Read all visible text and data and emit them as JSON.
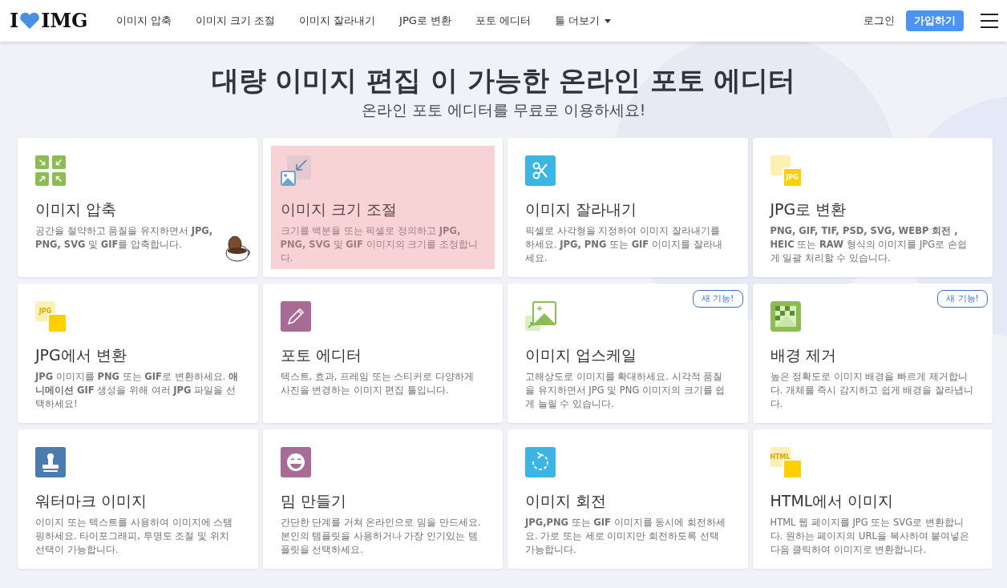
{
  "logo": {
    "left": "I",
    "right": "IMG"
  },
  "nav": {
    "items": [
      {
        "label": "이미지 압축"
      },
      {
        "label": "이미지 크기 조절"
      },
      {
        "label": "이미지 잘라내기"
      },
      {
        "label": "JPG로 변환"
      },
      {
        "label": "포토 에디터"
      },
      {
        "label": "툴 더보기",
        "dropdown": true
      }
    ],
    "login": "로그인",
    "signup": "가입하기"
  },
  "hero": {
    "title": "대량 이미지 편집 이 가능한 온라인 포토 에디터",
    "subtitle": "온라인 포토 에디터를 무료로 이용하세요!"
  },
  "tools": [
    {
      "kind": "compress",
      "title": "이미지 압축",
      "description": "공간을 절약하고 품질을 유지하면서 **JPG, PNG, SVG** 및 **GIF**를 압축합니다.",
      "highlighted": false,
      "mascot": true
    },
    {
      "kind": "resize",
      "title": "이미지 크기 조절",
      "description": "크기를 백분율 또는 픽셀로 정의하고 **JPG, PNG, SVG** 및 **GIF** 이미지의 크기를 조정합니다.",
      "highlighted": true
    },
    {
      "kind": "crop",
      "title": "이미지 잘라내기",
      "description": "픽셀로 사각형을 지정하여 이미지 잘라내기를 하세요. **JPG, PNG** 또는 **GIF** 이미지를 잘라내세요.",
      "highlighted": false
    },
    {
      "kind": "to-jpg",
      "icon_label": "JPG",
      "title": "JPG로 변환",
      "description": "**PNG, GIF, TIF, PSD, SVG, WEBP 회전 , HEIC** 또는 **RAW** 형식의 이미지를 JPG로 손쉽게 일괄 처리할 수 있습니다.",
      "highlighted": false
    },
    {
      "kind": "from-jpg",
      "icon_label": "JPG",
      "title": "JPG에서 변환",
      "description": "**JPG** 이미지를 **PNG** 또는 **GIF**로 변환하세요. **애니메이션 GIF** 생성을 위해 여러 **JPG** 파일을 선택하세요!",
      "highlighted": false
    },
    {
      "kind": "edit",
      "title": "포토 에디터",
      "description": "텍스트, 효과, 프레임 또는 스티커로 다양하게 사진을 변경하는 이미지 편집 툴입니다.",
      "highlighted": false
    },
    {
      "kind": "upscale",
      "title": "이미지 업스케일",
      "description": "고해상도로 이미지를 확대하세요. 시각적 품질을 유지하면서 JPG 및 PNG 이미지의 크기를 쉽게 늘릴 수 있습니다.",
      "highlighted": false,
      "badge": "새 기능!"
    },
    {
      "kind": "remove-bg",
      "title": "배경 제거",
      "description": "높은 정확도로 이미지 배경을 빠르게 제거합니다. 개체를 즉시 감지하고 쉽게 배경을 잘라냅니다.",
      "highlighted": false,
      "badge": "새 기능!"
    },
    {
      "kind": "watermark",
      "title": "워터마크 이미지",
      "description": "이미지 또는 텍스트를 사용하여 이미지에 스탬핑하세요. 타이포그래피, 투명도 조절 및 위치 선택이 가능합니다.",
      "highlighted": false
    },
    {
      "kind": "meme",
      "title": "밈 만들기",
      "description": "간단한 단계를 거쳐 온라인으로 밈을 만드세요. 본인의 템플릿을 사용하거나 가장 인기있는 템플릿을 선택하세요.",
      "highlighted": false
    },
    {
      "kind": "rotate",
      "title": "이미지 회전",
      "description": "**JPG,PNG** 또는 **GIF** 이미지를 동시에 회전하세요. 가로 또는 세로 이미지만 회전하도록 선택 가능합니다.",
      "highlighted": false
    },
    {
      "kind": "html",
      "icon_label": "HTML",
      "title": "HTML에서 이미지",
      "description": "HTML 웹 페이지를 JPG 또는 SVG로 변환합니다. 원하는 페이지의 URL을 복사하여 붙여넣은 다음 클릭하여 이미지로 변환합니다.",
      "highlighted": false
    }
  ]
}
